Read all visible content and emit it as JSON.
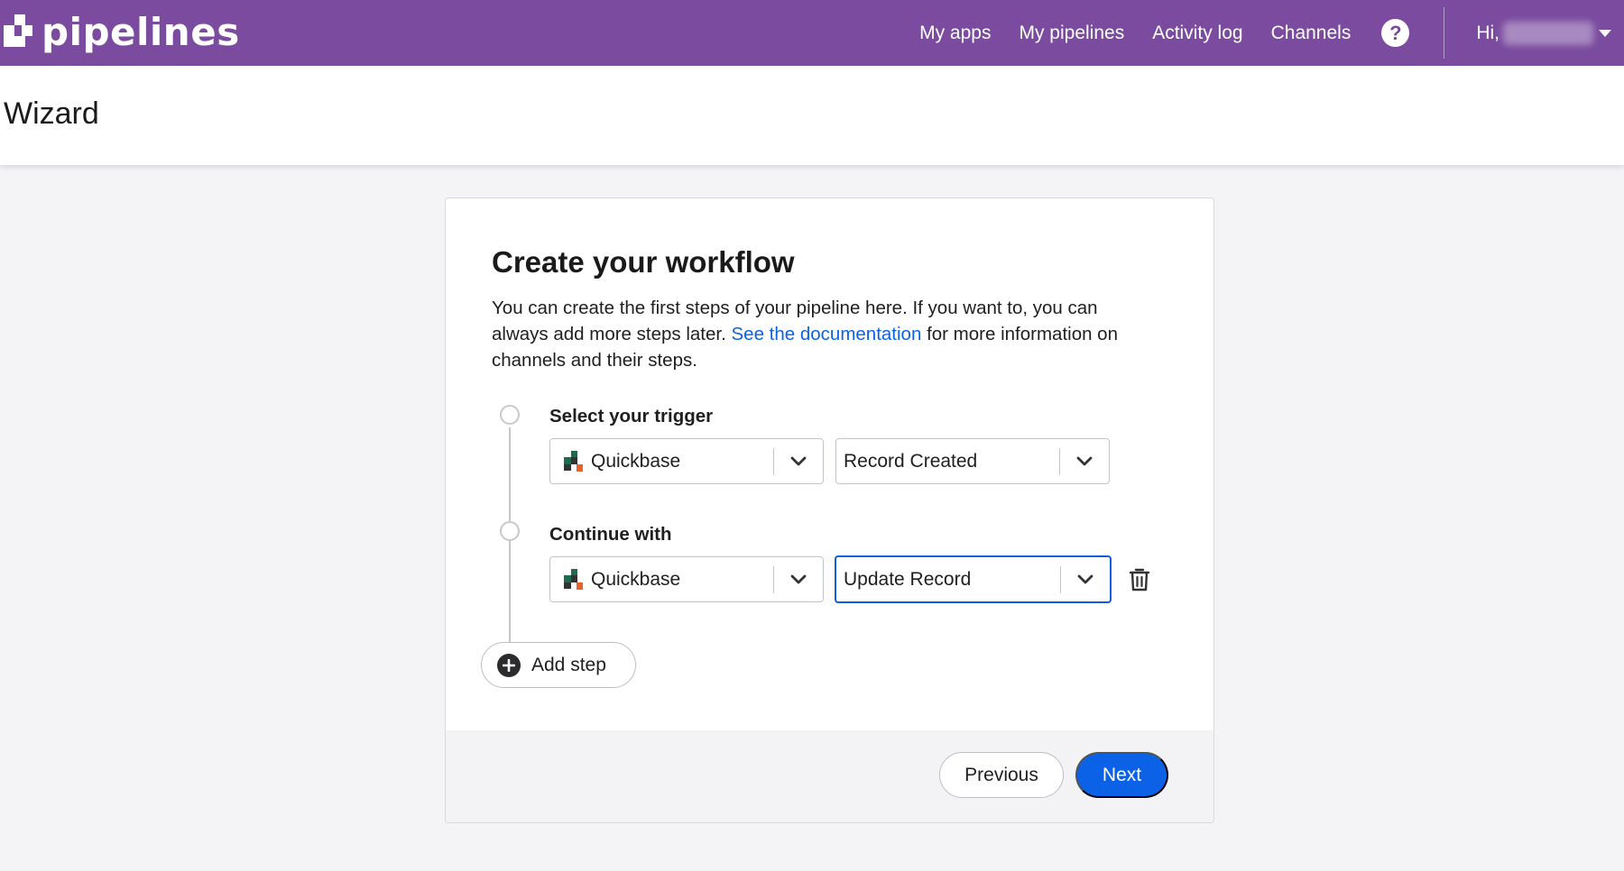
{
  "app": {
    "brand": "pipelines",
    "nav": [
      {
        "label": "My apps"
      },
      {
        "label": "My pipelines"
      },
      {
        "label": "Activity log"
      },
      {
        "label": "Channels"
      }
    ],
    "help_icon": "question-circle-icon",
    "greeting": "Hi,",
    "accent_color": "#7a4b9f"
  },
  "page": {
    "title": "Wizard"
  },
  "wizard": {
    "heading": "Create your workflow",
    "description_part1": "You can create the first steps of your pipeline here. If you want to, you can always add more steps later.",
    "doc_link": "See the documentation",
    "description_part2": "for more information on channels and their steps.",
    "steps": [
      {
        "label": "Select your trigger",
        "channel": "Quickbase",
        "action": "Record Created"
      },
      {
        "label": "Continue with",
        "channel": "Quickbase",
        "action": "Update Record"
      }
    ],
    "add_step_label": "Add step",
    "previous_label": "Previous",
    "next_label": "Next",
    "primary_color": "#0b62e6"
  }
}
